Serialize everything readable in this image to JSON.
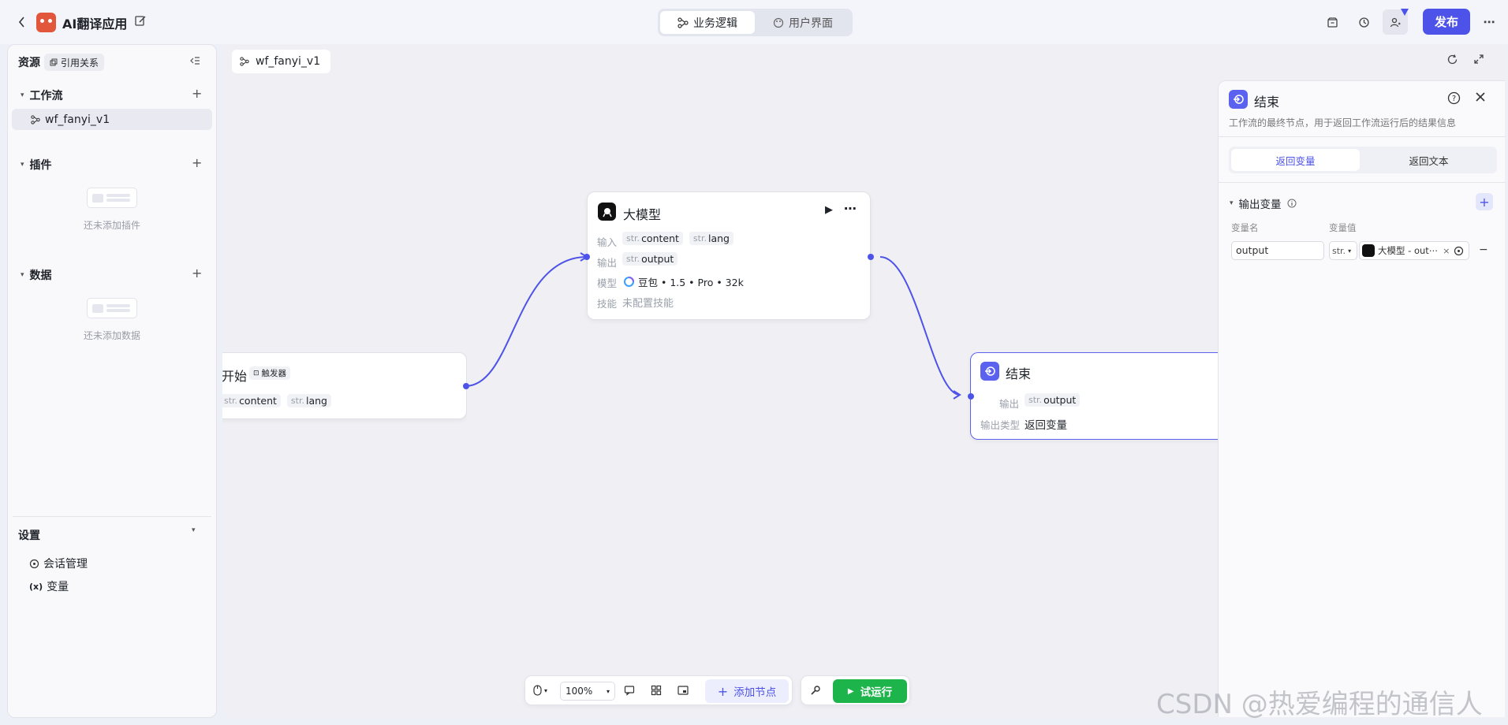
{
  "app": {
    "title": "AI翻译应用",
    "back_icon": "chevron-left-icon",
    "edit_icon": "edit-icon"
  },
  "tabs": [
    {
      "label": "业务逻辑",
      "active": true
    },
    {
      "label": "用户界面",
      "active": false
    }
  ],
  "header_actions": {
    "publish_label": "发布"
  },
  "sidebar": {
    "resources_label": "资源",
    "references_label": "引用关系",
    "workflow": {
      "title": "工作流",
      "items": [
        "wf_fanyi_v1"
      ]
    },
    "plugins": {
      "title": "插件",
      "empty_text": "还未添加插件"
    },
    "data": {
      "title": "数据",
      "empty_text": "还未添加数据"
    },
    "settings": {
      "title": "设置",
      "items": [
        "会话管理",
        "变量"
      ]
    }
  },
  "canvas": {
    "tab_label": "wf_fanyi_v1",
    "start_node": {
      "title": "开始",
      "badge": "触发器",
      "tags": [
        "content",
        "lang"
      ],
      "type_prefix": "str."
    },
    "llm_node": {
      "title": "大模型",
      "input_label": "输入",
      "inputs": [
        "content",
        "lang"
      ],
      "output_label": "输出",
      "outputs": [
        "output"
      ],
      "model_label": "模型",
      "model_value": "豆包 • 1.5 • Pro • 32k",
      "skill_label": "技能",
      "skill_value": "未配置技能"
    },
    "end_node": {
      "title": "结束",
      "output_label": "输出",
      "outputs": [
        "output"
      ],
      "output_type_label": "输出类型",
      "output_type_value": "返回变量"
    }
  },
  "toolbar": {
    "zoom": "100%",
    "add_node_label": "添加节点",
    "test_run_label": "试运行"
  },
  "panel": {
    "title": "结束",
    "description": "工作流的最终节点，用于返回工作流运行后的结果信息",
    "tabs": [
      {
        "label": "返回变量",
        "active": true
      },
      {
        "label": "返回文本",
        "active": false
      }
    ],
    "section_title": "输出变量",
    "col_name": "变量名",
    "col_value": "变量值",
    "row": {
      "name": "output",
      "type": "str.",
      "ref": "大模型 - out⋯"
    }
  },
  "watermark": "CSDN @热爱编程的通信人",
  "colors": {
    "accent": "#4d53e8",
    "run_green": "#1db44b"
  }
}
